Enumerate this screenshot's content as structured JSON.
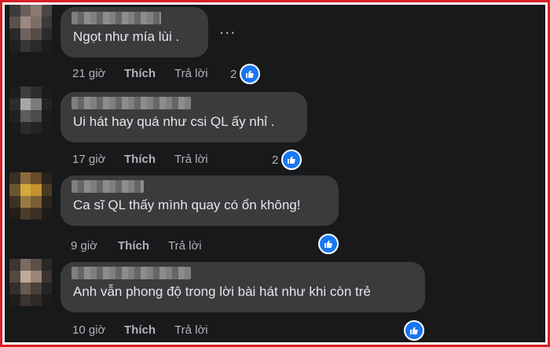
{
  "comments": [
    {
      "text": "Ngọt như mía lùi .",
      "time": "21 giờ",
      "like_label": "Thích",
      "reply_label": "Trả lời",
      "reaction_count": "2",
      "more_label": "..."
    },
    {
      "text": "Ui hát hay quá như csi QL ấy nhỉ .",
      "time": "17 giờ",
      "like_label": "Thích",
      "reply_label": "Trả lời",
      "reaction_count": "2"
    },
    {
      "text": "Ca sĩ QL thấy mình quay có ổn không!",
      "time": "9 giờ",
      "like_label": "Thích",
      "reply_label": "Trả lời",
      "reaction_count": ""
    },
    {
      "text": "Anh vẫn phong độ trong lời bài hát như khi còn trẻ",
      "time": "10 giờ",
      "like_label": "Thích",
      "reply_label": "Trả lời",
      "reaction_count": ""
    }
  ],
  "icons": {
    "reaction": "like-icon",
    "more": "more-icon"
  },
  "colors": {
    "background": "#18191a",
    "bubble": "#3a3b3c",
    "text": "#e4e6eb",
    "meta": "#b0b3b8",
    "like": "#1877f2",
    "frame": "#d81f26"
  }
}
